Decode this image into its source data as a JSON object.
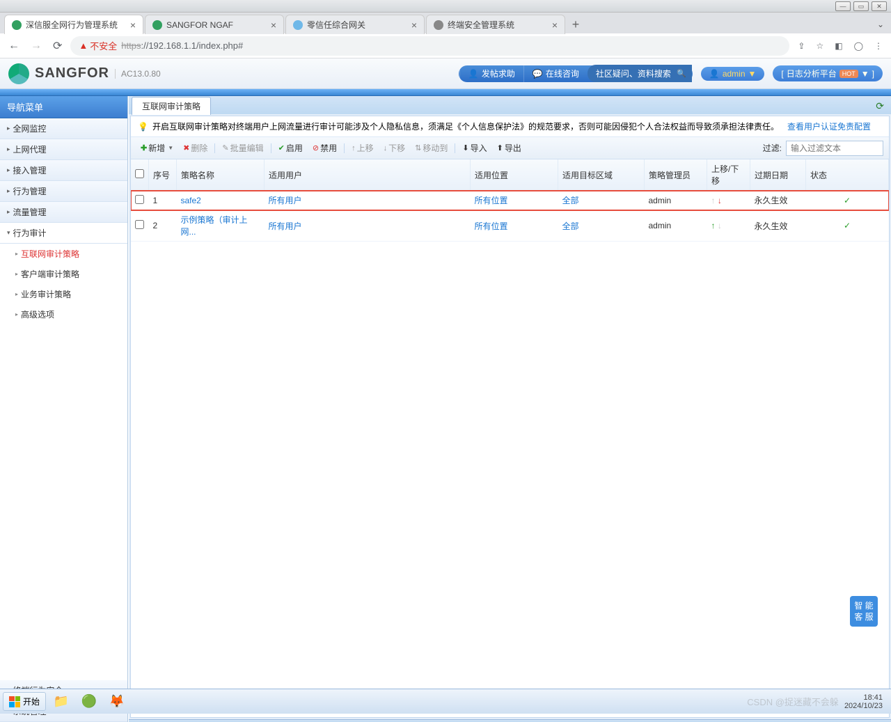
{
  "window": {
    "min": "—",
    "max": "▭",
    "close": "✕"
  },
  "tabs": [
    {
      "title": "深信服全网行为管理系统",
      "color": "#32a060",
      "active": true
    },
    {
      "title": "SANGFOR NGAF",
      "color": "#32a060",
      "active": false
    },
    {
      "title": "零信任综合网关",
      "color": "#6fb8e8",
      "active": false
    },
    {
      "title": "终端安全管理系统",
      "color": "#888888",
      "active": false
    }
  ],
  "addr": {
    "back": "←",
    "fwd": "→",
    "reload": "⟳",
    "danger_icon": "▲",
    "danger_text": "不安全",
    "https": "https",
    "sep": "://",
    "host": "192.168.1.1",
    "path": "/index.php#",
    "share": "⇪",
    "star": "☆",
    "ext": "◧",
    "user": "◯",
    "menu": "⋮"
  },
  "brand": {
    "name": "SANGFOR",
    "version": "AC13.0.80"
  },
  "header": {
    "help_icon": "👤",
    "help": "发帖求助",
    "chat_icon": "💬",
    "chat": "在线咨询",
    "search": "社区疑问、资料搜索",
    "user_icon": "👤",
    "user": "admin",
    "dd": "▼",
    "log_open": "[",
    "log": "日志分析平台",
    "hot": "HOT",
    "log_dd": "▼",
    "log_close": "]"
  },
  "sidebar": {
    "title": "导航菜单",
    "sections": [
      {
        "label": "全网监控",
        "expanded": false
      },
      {
        "label": "上网代理",
        "expanded": false
      },
      {
        "label": "接入管理",
        "expanded": false
      },
      {
        "label": "行为管理",
        "expanded": false
      },
      {
        "label": "流量管理",
        "expanded": false
      },
      {
        "label": "行为审计",
        "expanded": true,
        "children": [
          {
            "label": "互联网审计策略",
            "active": true
          },
          {
            "label": "客户端审计策略",
            "active": false
          },
          {
            "label": "业务审计策略",
            "active": false
          },
          {
            "label": "高级选项",
            "active": false
          }
        ]
      }
    ],
    "bottom": [
      {
        "label": "终端行为安全"
      },
      {
        "label": "系统管理"
      }
    ]
  },
  "main": {
    "tab": "互联网审计策略",
    "notice": "开启互联网审计策略对终端用户上网流量进行审计可能涉及个人隐私信息，须满足《个人信息保护法》的规范要求，否则可能因侵犯个人合法权益而导致须承担法律责任。",
    "notice_link": "查看用户认证免责配置",
    "toolbar": {
      "add": "新增",
      "del": "删除",
      "batch": "批量编辑",
      "enable": "启用",
      "disable": "禁用",
      "up": "上移",
      "down": "下移",
      "move": "移动到",
      "import": "导入",
      "export": "导出",
      "filter_label": "过滤:",
      "filter_placeholder": "输入过滤文本"
    },
    "columns": [
      "",
      "序号",
      "策略名称",
      "适用用户",
      "适用位置",
      "适用目标区域",
      "策略管理员",
      "上移/下移",
      "过期日期",
      "状态"
    ],
    "rows": [
      {
        "idx": "1",
        "name": "safe2",
        "user": "所有用户",
        "loc": "所有位置",
        "area": "全部",
        "admin": "admin",
        "up_dim": true,
        "down_active": true,
        "expire": "永久生效",
        "status": "✓",
        "highlight": true
      },
      {
        "idx": "2",
        "name": "示例策略（审计上网...",
        "user": "所有用户",
        "loc": "所有位置",
        "area": "全部",
        "admin": "admin",
        "up_active": true,
        "down_dim": true,
        "expire": "永久生效",
        "status": "✓",
        "highlight": false
      }
    ],
    "smart_service": "智 能\n客 服"
  },
  "taskbar": {
    "start": "开始",
    "watermark": "CSDN @捉迷藏不会躲",
    "time": "18:41",
    "date": "2024/10/23"
  }
}
